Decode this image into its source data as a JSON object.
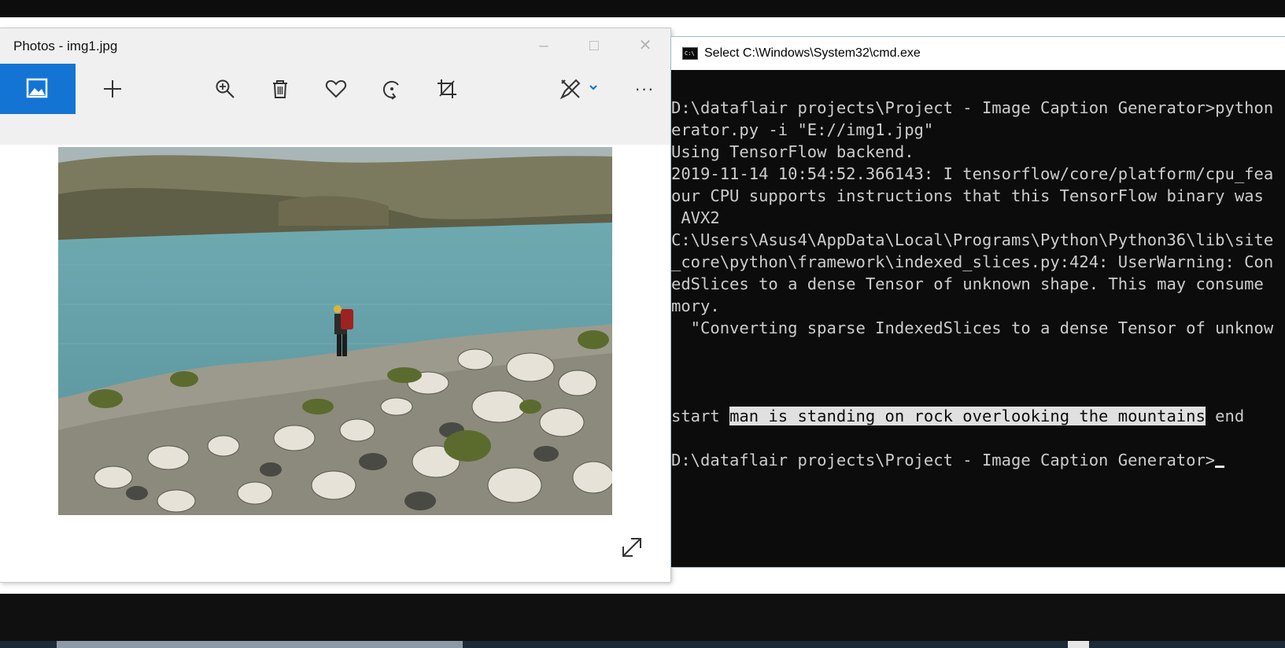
{
  "photos": {
    "title": "Photos - img1.jpg",
    "toolbar": {
      "view": "image-view-icon",
      "add": "plus-icon",
      "zoom": "zoom-in-icon",
      "delete": "trash-icon",
      "favorite": "heart-icon",
      "rotate": "rotate-icon",
      "crop": "crop-icon",
      "edit": "edit-create-icon",
      "more": "more-icon"
    },
    "more_label": "···",
    "accent_color": "#1474d4"
  },
  "cmd": {
    "title": "Select C:\\Windows\\System32\\cmd.exe",
    "lines": [
      "D:\\dataflair projects\\Project - Image Caption Generator>python",
      "erator.py -i \"E://img1.jpg\"",
      "Using TensorFlow backend.",
      "2019-11-14 10:54:52.366143: I tensorflow/core/platform/cpu_fea",
      "our CPU supports instructions that this TensorFlow binary was",
      " AVX2",
      "C:\\Users\\Asus4\\AppData\\Local\\Programs\\Python\\Python36\\lib\\site",
      "_core\\python\\framework\\indexed_slices.py:424: UserWarning: Con",
      "edSlices to a dense Tensor of unknown shape. This may consume",
      "mory.",
      "  \"Converting sparse IndexedSlices to a dense Tensor of unknow"
    ],
    "caption": {
      "start": "start",
      "text": "man is standing on rock overlooking the mountains",
      "end": "end"
    },
    "prompt": "D:\\dataflair projects\\Project - Image Caption Generator>"
  }
}
